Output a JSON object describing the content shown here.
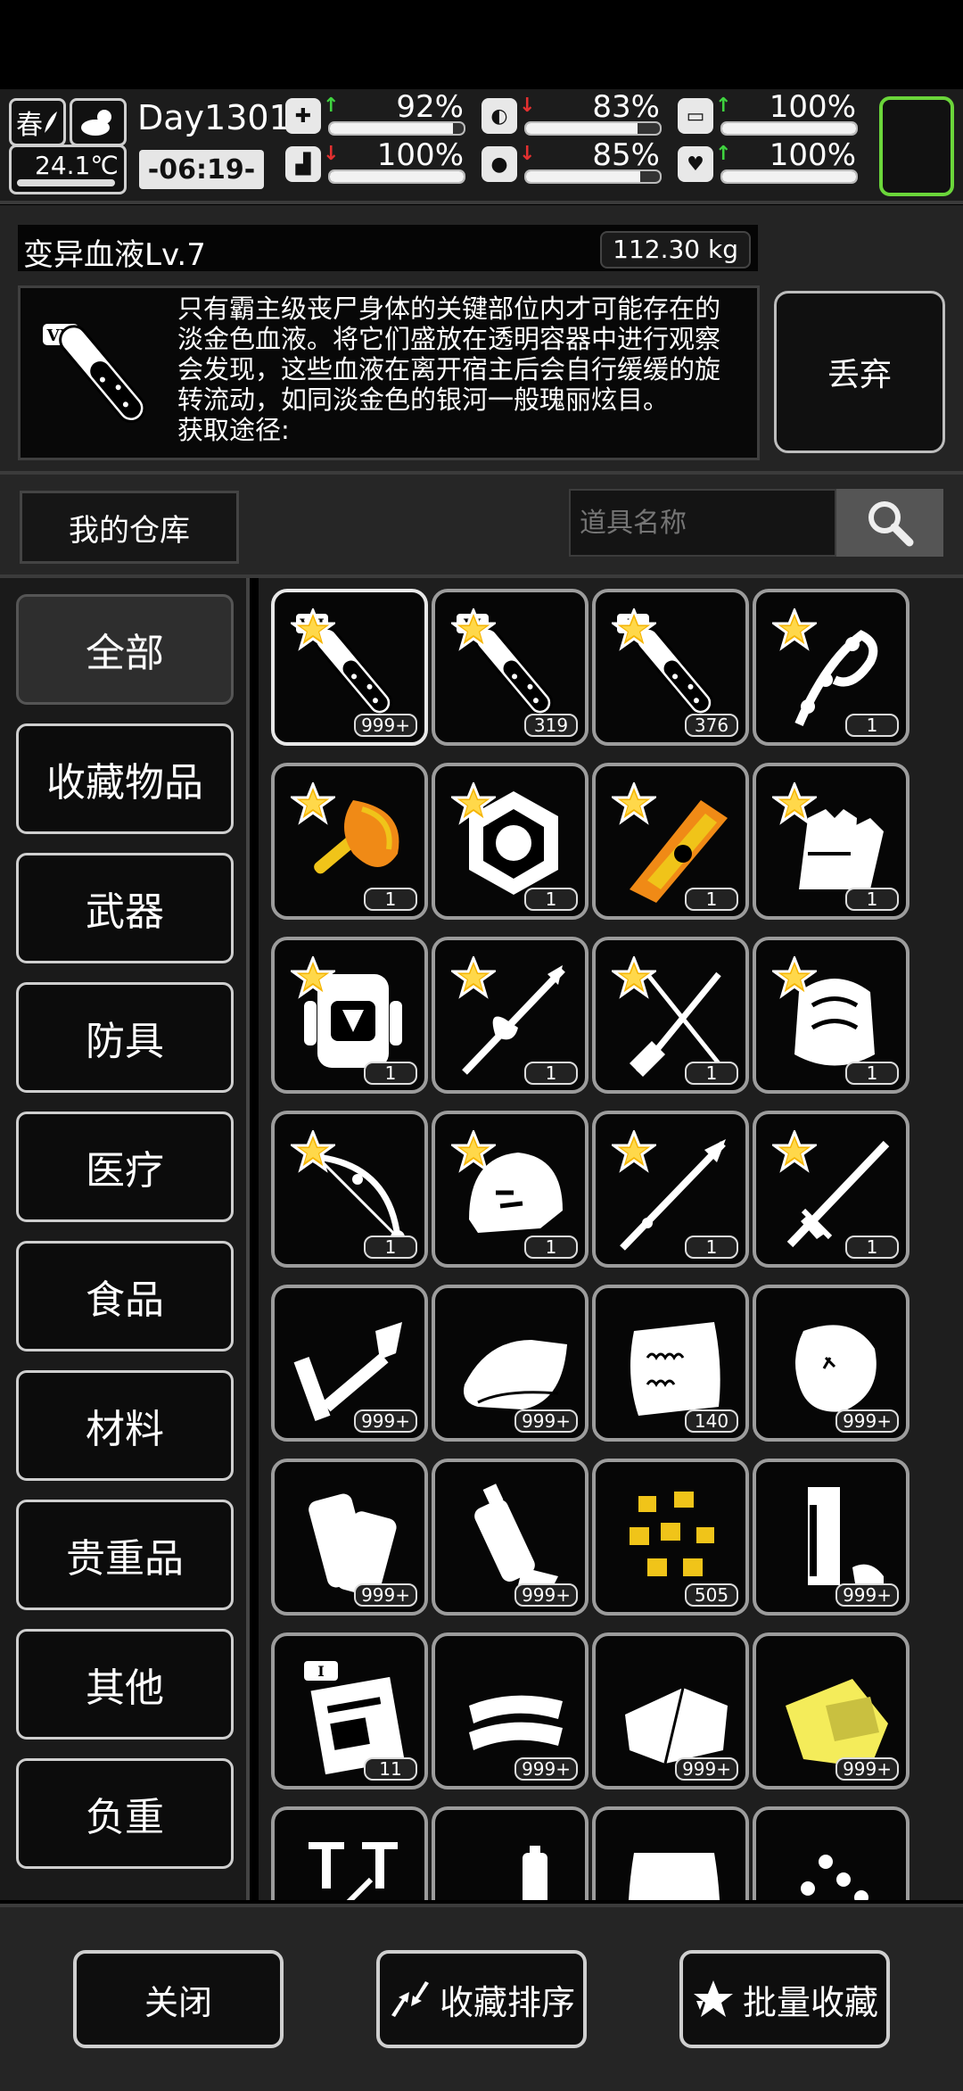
{
  "status": {
    "season": "春",
    "temperature": "24.1℃",
    "day": "Day1301",
    "time": "-06:19-",
    "stats": [
      {
        "icon": "medical-kit-icon",
        "trend": "up",
        "trend_color": "#3fd33f",
        "value": "92%",
        "fill": 0.92
      },
      {
        "icon": "stomach-icon",
        "trend": "down",
        "trend_color": "#e33030",
        "value": "83%",
        "fill": 0.83
      },
      {
        "icon": "bladder-icon",
        "trend": "up",
        "trend_color": "#3fd33f",
        "value": "100%",
        "fill": 1.0
      },
      {
        "icon": "boot-icon",
        "trend": "down",
        "trend_color": "#e33030",
        "value": "100%",
        "fill": 1.0
      },
      {
        "icon": "water-drop-icon",
        "trend": "down",
        "trend_color": "#e33030",
        "value": "85%",
        "fill": 0.85
      },
      {
        "icon": "heart-icon",
        "trend": "up",
        "trend_color": "#3fd33f",
        "value": "100%",
        "fill": 1.0
      }
    ],
    "highlight_color": "#6bd63a"
  },
  "item": {
    "name": "变异血液Lv.7",
    "weight": "112.30 kg",
    "description": "只有霸主级丧尸身体的关键部位内才可能存在的淡金色血液。将它们盛放在透明容器中进行观察会发现，这些血液在离开宿主后会自行缓缓的旋转流动，如同淡金色的银河一般瑰丽炫目。",
    "source_label": "获取途径:",
    "discard_label": "丢弃"
  },
  "warehouse": {
    "label": "我的仓库",
    "search_placeholder": "道具名称"
  },
  "categories": [
    "全部",
    "收藏物品",
    "武器",
    "防具",
    "医疗",
    "食品",
    "材料",
    "贵重品",
    "其他",
    "负重"
  ],
  "active_category": "全部",
  "items": [
    {
      "icon": "blood-vial-vii-icon",
      "count": "999+",
      "fav": true,
      "selected": true
    },
    {
      "icon": "blood-vial-vi-icon",
      "count": "319",
      "fav": true
    },
    {
      "icon": "blood-vial-v-icon",
      "count": "376",
      "fav": true
    },
    {
      "icon": "bone-whip-icon",
      "count": "1",
      "fav": true
    },
    {
      "icon": "golden-mace-icon",
      "count": "1",
      "fav": true
    },
    {
      "icon": "hex-shield-icon",
      "count": "1",
      "fav": true
    },
    {
      "icon": "golden-cannon-icon",
      "count": "1",
      "fav": true
    },
    {
      "icon": "armored-gloves-icon",
      "count": "1",
      "fav": true
    },
    {
      "icon": "backpack-icon",
      "count": "1",
      "fav": true
    },
    {
      "icon": "spear-icon",
      "count": "1",
      "fav": true
    },
    {
      "icon": "shovel-axe-icon",
      "count": "1",
      "fav": true
    },
    {
      "icon": "armor-chest-icon",
      "count": "1",
      "fav": true
    },
    {
      "icon": "compound-bow-icon",
      "count": "1",
      "fav": true
    },
    {
      "icon": "helmet-icon",
      "count": "1",
      "fav": true
    },
    {
      "icon": "long-spear-icon",
      "count": "1",
      "fav": true
    },
    {
      "icon": "great-sword-icon",
      "count": "1",
      "fav": true
    },
    {
      "icon": "wrench-tool-icon",
      "count": "999+",
      "fav": false
    },
    {
      "icon": "cloth-roll-icon",
      "count": "999+",
      "fav": false
    },
    {
      "icon": "fur-pelt-icon",
      "count": "140",
      "fav": false
    },
    {
      "icon": "raw-meat-icon",
      "count": "999+",
      "fav": false
    },
    {
      "icon": "paper-roll-icon",
      "count": "999+",
      "fav": false
    },
    {
      "icon": "plastic-bottle-icon",
      "count": "999+",
      "fav": false
    },
    {
      "icon": "gold-nugget-icon",
      "count": "505",
      "fav": false
    },
    {
      "icon": "metal-bar-icon",
      "count": "999+",
      "fav": false
    },
    {
      "icon": "blueprint-icon",
      "count": "11",
      "fav": false
    },
    {
      "icon": "rope-coil-icon",
      "count": "999+",
      "fav": false
    },
    {
      "icon": "folded-cloth-icon",
      "count": "999+",
      "fav": false
    },
    {
      "icon": "yellow-cloth-icon",
      "count": "999+",
      "fav": false
    },
    {
      "icon": "syringe-icon",
      "count": "",
      "fav": false
    },
    {
      "icon": "battery-icon",
      "count": "",
      "fav": false
    },
    {
      "icon": "sack-icon",
      "count": "",
      "fav": false
    },
    {
      "icon": "pearls-icon",
      "count": "",
      "fav": false
    }
  ],
  "bottom": {
    "close_label": "关闭",
    "sort_label": "收藏排序",
    "batch_label": "批量收藏"
  }
}
